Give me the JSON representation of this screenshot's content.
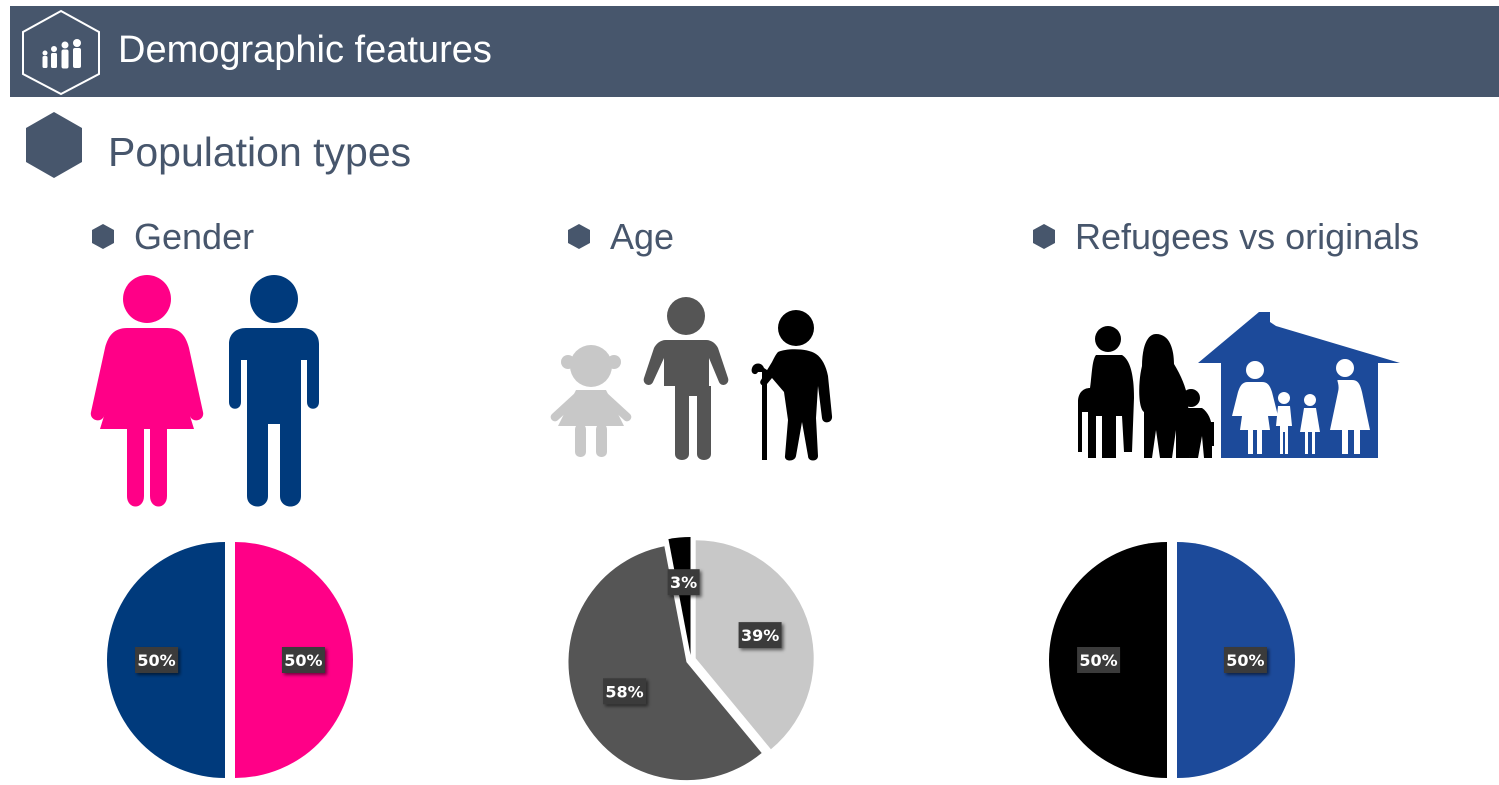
{
  "header": {
    "title": "Demographic features",
    "icon": "family-icon",
    "background": "#47566c"
  },
  "section": {
    "title": "Population types"
  },
  "columns": [
    {
      "heading": "Gender",
      "illustration": "woman-man-icon"
    },
    {
      "heading": "Age",
      "illustration": "child-adult-elderly-icon"
    },
    {
      "heading": "Refugees vs originals",
      "illustration": "refugees-house-icon"
    }
  ],
  "chart_data": [
    {
      "type": "pie",
      "title": "",
      "categories": [
        "",
        ""
      ],
      "values": [
        50,
        50
      ],
      "labels": [
        "50%",
        "50%"
      ],
      "colors": [
        "#ff0087",
        "#003a7c"
      ]
    },
    {
      "type": "pie",
      "title": "",
      "categories": [
        "",
        "",
        ""
      ],
      "values": [
        39,
        58,
        3
      ],
      "labels": [
        "39%",
        "58%",
        "3%"
      ],
      "colors": [
        "#c8c8c8",
        "#555555",
        "#000000"
      ]
    },
    {
      "type": "pie",
      "title": "",
      "categories": [
        "",
        ""
      ],
      "values": [
        50,
        50
      ],
      "labels": [
        "50%",
        "50%"
      ],
      "colors": [
        "#1c4a9a",
        "#000000"
      ]
    }
  ]
}
